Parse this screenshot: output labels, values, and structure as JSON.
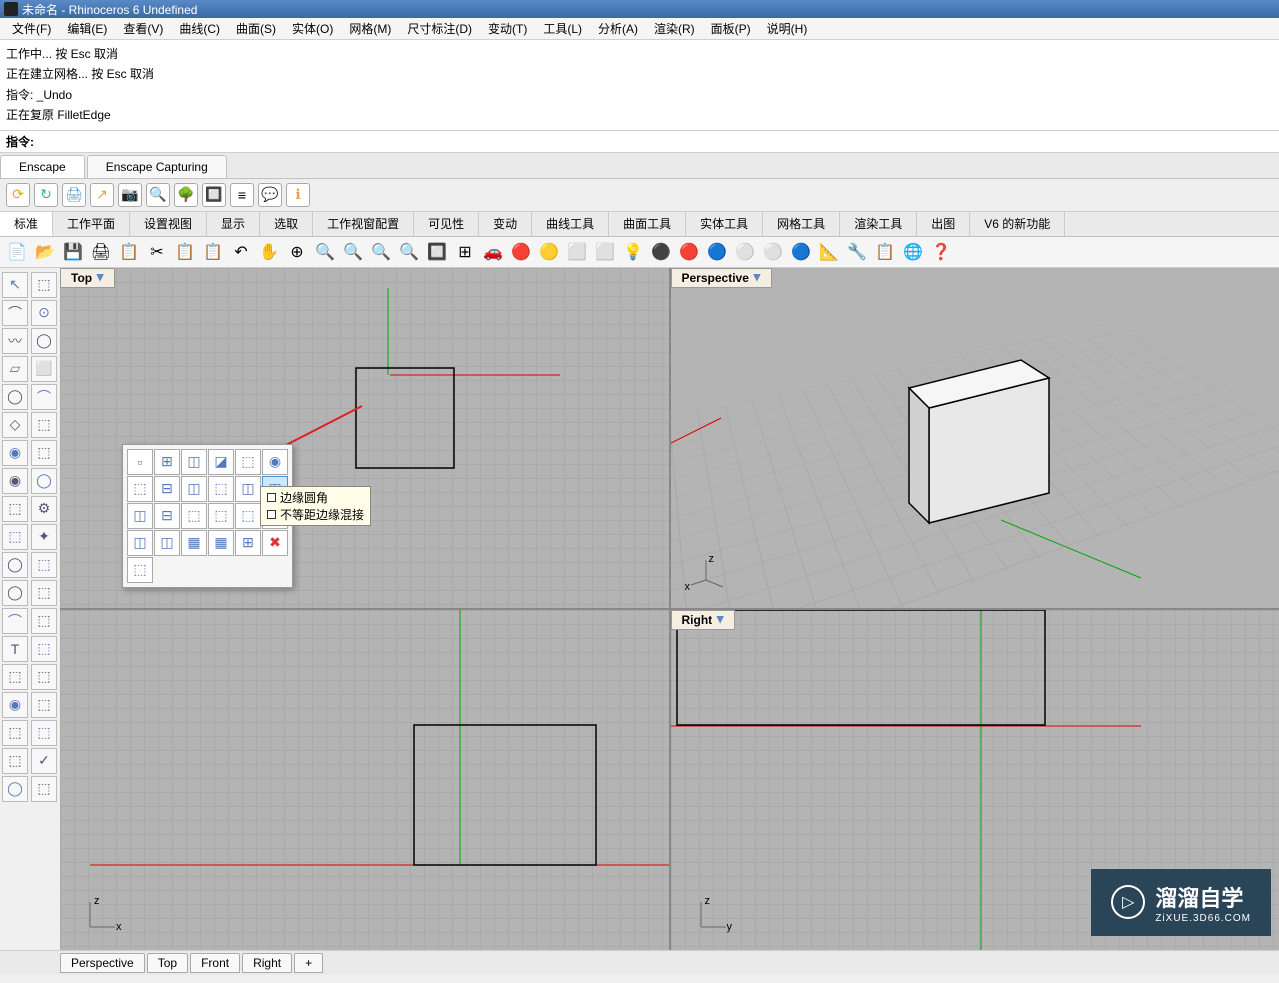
{
  "title": "未命名 - Rhinoceros 6 Undefined",
  "menu": [
    "文件(F)",
    "编辑(E)",
    "查看(V)",
    "曲线(C)",
    "曲面(S)",
    "实体(O)",
    "网格(M)",
    "尺寸标注(D)",
    "变动(T)",
    "工具(L)",
    "分析(A)",
    "渲染(R)",
    "面板(P)",
    "说明(H)"
  ],
  "history": [
    "工作中... 按 Esc 取消",
    "正在建立网格... 按 Esc 取消",
    "指令: _Undo",
    "正在复原 FilletEdge"
  ],
  "command_label": "指令:",
  "plugin_tabs": [
    "Enscape",
    "Enscape Capturing"
  ],
  "plugin_icons": [
    "⟳",
    "↻",
    "🖨",
    "↗",
    "📷",
    "🔍",
    "🌳",
    "🔲",
    "≡",
    "💬",
    "ℹ"
  ],
  "toolbar_tabs": [
    "标准",
    "工作平面",
    "设置视图",
    "显示",
    "选取",
    "工作视窗配置",
    "可见性",
    "变动",
    "曲线工具",
    "曲面工具",
    "实体工具",
    "网格工具",
    "渲染工具",
    "出图",
    "V6 的新功能"
  ],
  "main_tb": [
    "📄",
    "📂",
    "💾",
    "🖨",
    "📋",
    "✂",
    "📋",
    "📋",
    "↶",
    "✋",
    "⊕",
    "🔍",
    "🔍",
    "🔍",
    "🔍",
    "🔲",
    "⊞",
    "🚗",
    "🔴",
    "🟡",
    "⬜",
    "⬜",
    "💡",
    "⚫",
    "🔴",
    "🔵",
    "⚪",
    "⚪",
    "🔵",
    "📐",
    "🔧",
    "📋",
    "🌐",
    "❓"
  ],
  "left_tools": [
    "↖",
    "⬚",
    "⌒",
    "⊙",
    "〰",
    "◯",
    "▱",
    "⬜",
    "◯",
    "⌒",
    "◇",
    "⬚",
    "◉",
    "⬚",
    "◉",
    "◯",
    "⬚",
    "⚙",
    "⬚",
    "✦",
    "◯",
    "⬚",
    "◯",
    "⬚",
    "⌒",
    "⬚",
    "T",
    "⬚",
    "⬚",
    "⬚",
    "◉",
    "⬚",
    "⬚",
    "⬚",
    "⬚",
    "✓",
    "◯",
    "⬚"
  ],
  "viewports": {
    "top": "Top",
    "perspective": "Perspective",
    "front_implied": "",
    "right": "Right"
  },
  "axis_labels": {
    "xy": {
      "z": "z",
      "x": "x"
    },
    "yz": {
      "z": "z",
      "y": "y"
    }
  },
  "flyout_icons": [
    "▫",
    "⊞",
    "◫",
    "◪",
    "⬚",
    "◉",
    "⬚",
    "⊟",
    "◫",
    "⬚",
    "◫",
    "◫",
    "◫",
    "⊟",
    "⬚",
    "⬚",
    "⬚",
    "⬚",
    "◫",
    "◫",
    "▦",
    "▦",
    "⊞",
    "✖",
    "⬚"
  ],
  "tooltip": {
    "line1": "边缘圆角",
    "line2": "不等距边缘混接"
  },
  "bottom_tabs": [
    "Perspective",
    "Top",
    "Front",
    "Right",
    "+"
  ],
  "watermark": {
    "main": "溜溜自学",
    "sub": "ZiXUE.3D66.COM",
    "play": "▷"
  }
}
